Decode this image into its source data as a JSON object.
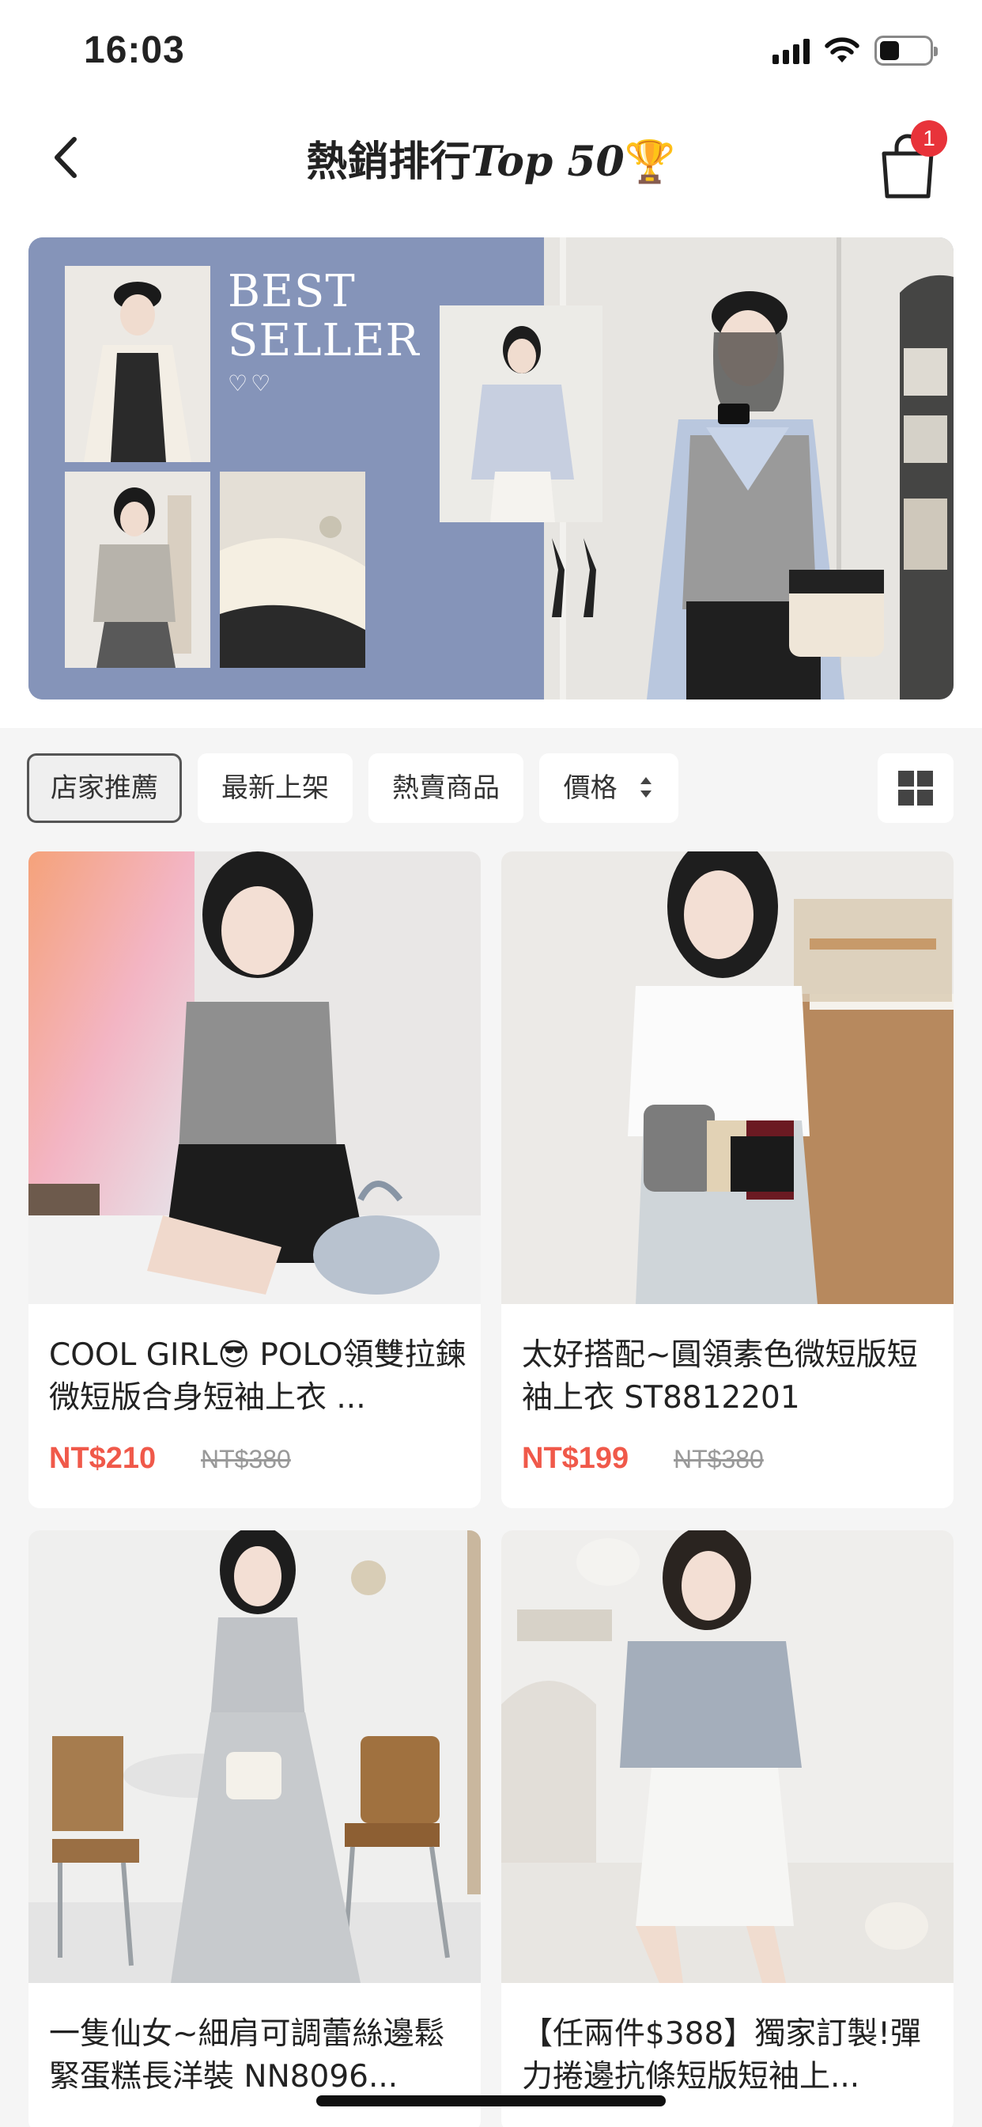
{
  "status_bar": {
    "time": "16:03"
  },
  "header": {
    "title_cjk": "熱銷排行",
    "title_latin": "Top 50",
    "title_emoji": "🏆",
    "cart_badge_count": "1"
  },
  "banner": {
    "title_line1": "BEST",
    "title_line2": "SELLER",
    "hearts": "♡♡"
  },
  "filters": {
    "chips": [
      "店家推薦",
      "最新上架",
      "熱賣商品",
      "價格"
    ],
    "active_index": 0
  },
  "products": [
    {
      "name": "COOL GIRL😎 POLO領雙拉鍊微短版合身短袖上衣 ...",
      "price": "NT$210",
      "original_price": "NT$380"
    },
    {
      "name": "太好搭配~圓領素色微短版短袖上衣 ST8812201",
      "price": "NT$199",
      "original_price": "NT$380"
    },
    {
      "name": "一隻仙女~細肩可調蕾絲邊鬆緊蛋糕長洋裝 NN8096...",
      "price": "",
      "original_price": ""
    },
    {
      "name": "【任兩件$388】獨家訂製!彈力捲邊抗條短版短袖上...",
      "price": "",
      "original_price": ""
    }
  ],
  "colors": {
    "accent_price": "#f0594a",
    "badge": "#e8333a",
    "banner_blue": "#8594b9",
    "section_bg": "#f5f5f5"
  }
}
